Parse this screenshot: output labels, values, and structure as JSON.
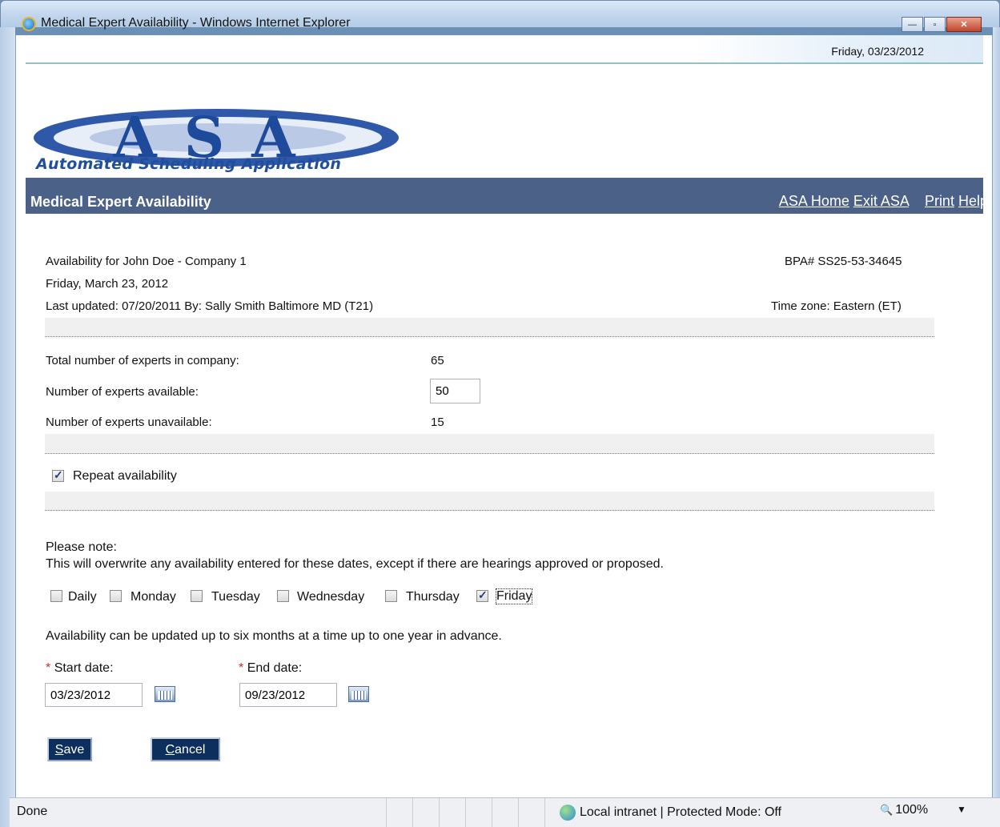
{
  "window": {
    "title": "Medical Expert Availability - Windows Internet Explorer",
    "buttons": {
      "minimize": "—",
      "maximize": "▫",
      "close": "✕"
    }
  },
  "date_bar": {
    "date": "Friday, 03/23/2012"
  },
  "logo": {
    "letters": "ASA",
    "tagline": "Automated Scheduling Application"
  },
  "header": {
    "title": "Medical Expert Availability",
    "links": [
      "ASA Home",
      "Exit ASA",
      "Print",
      "Help"
    ]
  },
  "info": {
    "availability_for": "Availability for John Doe - Company 1",
    "date": "Friday, March 23, 2012",
    "last_updated": "Last updated: 07/20/2011 By: Sally Smith Baltimore MD (T21)",
    "bpa": "BPA# SS25-53-34645",
    "timezone": "Time zone: Eastern (ET)"
  },
  "counts": {
    "total_label": "Total number of experts in company:",
    "total_value": "65",
    "available_label": "Number of experts available:",
    "available_value": "50",
    "unavailable_label": "Number of experts unavailable:",
    "unavailable_value": "15"
  },
  "repeat": {
    "label": "Repeat availability",
    "checked": true
  },
  "note": {
    "heading": "Please note:",
    "text": "This will overwrite any availability entered for these dates, except if there are hearings approved or proposed."
  },
  "days": [
    {
      "label": "Daily",
      "checked": false
    },
    {
      "label": "Monday",
      "checked": false
    },
    {
      "label": "Tuesday",
      "checked": false
    },
    {
      "label": "Wednesday",
      "checked": false
    },
    {
      "label": "Thursday",
      "checked": false
    },
    {
      "label": "Friday",
      "checked": true
    }
  ],
  "advance_note": "Availability can be updated up to six months at a time up to one year in advance.",
  "dates": {
    "start_label": "Start date:",
    "start_value": "03/23/2012",
    "end_label": "End date:",
    "end_value": "09/23/2012",
    "required_mark": "*"
  },
  "buttons": {
    "save": "Save",
    "cancel": "Cancel"
  },
  "status": {
    "done": "Done",
    "zone": "Local intranet | Protected Mode: Off",
    "zoom": "100%",
    "zoom_icon": "🔍",
    "dropdown": "▼"
  },
  "colors": {
    "header_bg": "#4c6187",
    "button_bg": "#0d2f5e",
    "required": "#d62b1f"
  }
}
